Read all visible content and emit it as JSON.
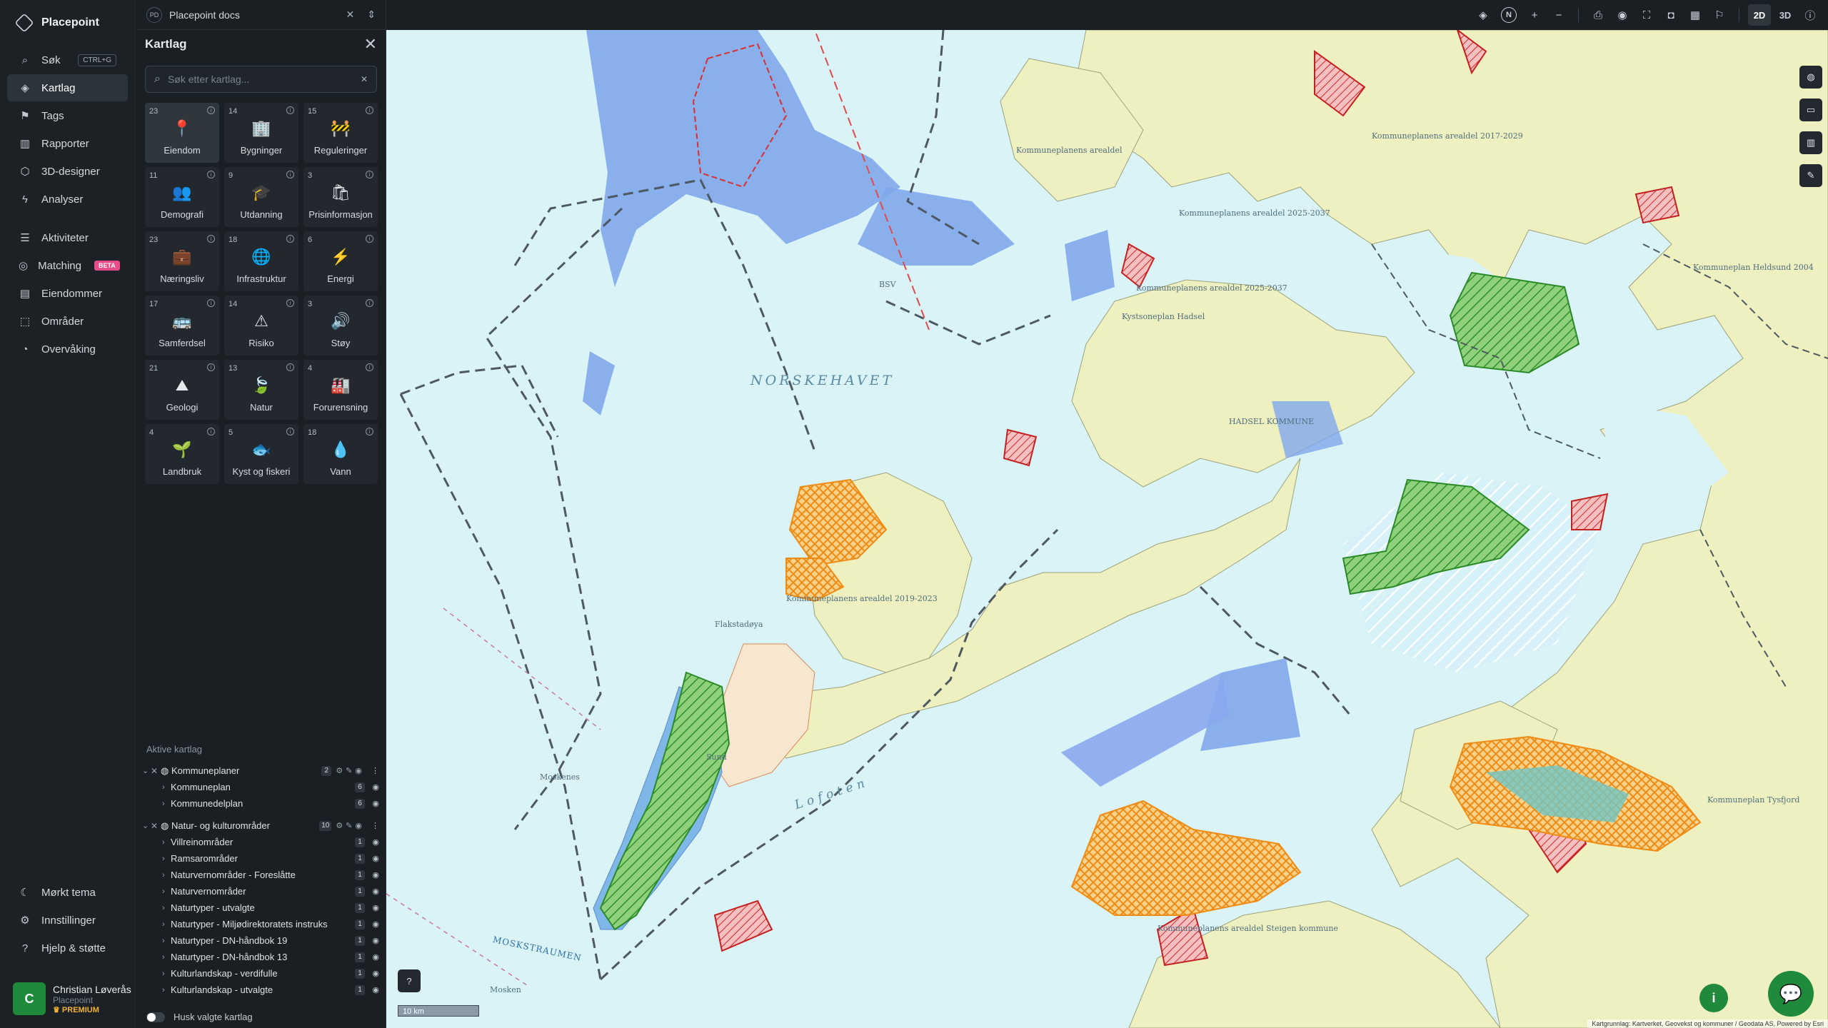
{
  "nav": {
    "brand": "Placepoint",
    "items": [
      {
        "label": "Søk",
        "shortcut": "CTRL+G"
      },
      {
        "label": "Kartlag"
      },
      {
        "label": "Tags"
      },
      {
        "label": "Rapporter"
      },
      {
        "label": "3D-designer"
      },
      {
        "label": "Analyser"
      },
      {
        "label": "Aktiviteter"
      },
      {
        "label": "Matching",
        "badge": "BETA"
      },
      {
        "label": "Eiendommer"
      },
      {
        "label": "Områder"
      },
      {
        "label": "Overvåking"
      }
    ],
    "bottom": [
      {
        "label": "Mørkt tema"
      },
      {
        "label": "Innstillinger"
      },
      {
        "label": "Hjelp & støtte"
      }
    ],
    "user": {
      "initial": "C",
      "name": "Christian Løverås",
      "org": "Placepoint",
      "plan": "PREMIUM"
    }
  },
  "doc": {
    "badge": "PD",
    "name": "Placepoint docs"
  },
  "panel": {
    "title": "Kartlag",
    "search_placeholder": "Søk etter kartlag...",
    "categories": [
      {
        "count": "23",
        "label": "Eiendom",
        "icon": "📍"
      },
      {
        "count": "14",
        "label": "Bygninger",
        "icon": "🏢"
      },
      {
        "count": "15",
        "label": "Reguleringer",
        "icon": "🚧"
      },
      {
        "count": "11",
        "label": "Demografi",
        "icon": "👥"
      },
      {
        "count": "9",
        "label": "Utdanning",
        "icon": "🎓"
      },
      {
        "count": "3",
        "label": "Prisinformasjon",
        "icon": "🛍"
      },
      {
        "count": "23",
        "label": "Næringsliv",
        "icon": "💼"
      },
      {
        "count": "18",
        "label": "Infrastruktur",
        "icon": "🌐"
      },
      {
        "count": "6",
        "label": "Energi",
        "icon": "⚡"
      },
      {
        "count": "17",
        "label": "Samferdsel",
        "icon": "🚌"
      },
      {
        "count": "14",
        "label": "Risiko",
        "icon": "⚠"
      },
      {
        "count": "3",
        "label": "Støy",
        "icon": "🔊"
      },
      {
        "count": "21",
        "label": "Geologi",
        "icon": "⛰"
      },
      {
        "count": "13",
        "label": "Natur",
        "icon": "🍃"
      },
      {
        "count": "4",
        "label": "Forurensning",
        "icon": "🏭"
      },
      {
        "count": "4",
        "label": "Landbruk",
        "icon": "🌱"
      },
      {
        "count": "5",
        "label": "Kyst og fiskeri",
        "icon": "🐟"
      },
      {
        "count": "18",
        "label": "Vann",
        "icon": "💧"
      }
    ],
    "active_title": "Aktive kartlag",
    "groups": [
      {
        "name": "Kommuneplaner",
        "count": "2",
        "children": [
          {
            "name": "Kommuneplan",
            "count": "6"
          },
          {
            "name": "Kommunedelplan",
            "count": "6"
          }
        ]
      },
      {
        "name": "Natur- og kulturområder",
        "count": "10",
        "children": [
          {
            "name": "Villreinområder",
            "count": "1"
          },
          {
            "name": "Ramsarområder",
            "count": "1"
          },
          {
            "name": "Naturvernområder - Foreslåtte",
            "count": "1"
          },
          {
            "name": "Naturvernområder",
            "count": "1"
          },
          {
            "name": "Naturtyper - utvalgte",
            "count": "1"
          },
          {
            "name": "Naturtyper - Miljødirektoratets instruks",
            "count": "1"
          },
          {
            "name": "Naturtyper - DN-håndbok 19",
            "count": "1"
          },
          {
            "name": "Naturtyper - DN-håndbok 13",
            "count": "1"
          },
          {
            "name": "Kulturlandskap - verdifulle",
            "count": "1"
          },
          {
            "name": "Kulturlandskap - utvalgte",
            "count": "1"
          }
        ]
      }
    ],
    "remember_label": "Husk valgte kartlag"
  },
  "toolbar": {
    "mode_2d": "2D",
    "mode_3d": "3D",
    "north": "N"
  },
  "map": {
    "labels": {
      "sea": "NORSKEHAVET",
      "lofoten": "Lofoten",
      "moskstraumen": "MOSKSTRAUMEN",
      "bsv": "BSV",
      "kp1": "Kommuneplanens arealdel",
      "kp2": "Kommuneplanens arealdel 2017-2029",
      "kp3": "Kommuneplanens arealdel 2025-2037",
      "kp4": "Kommuneplanens arealdel 2025-2037",
      "kp5": "Kommuneplanens arealdel 2019-2023",
      "kystsone": "Kystsoneplan Hadsel",
      "hadsel": "HADSEL KOMMUNE",
      "flakstad": "Flakstadøya",
      "moskenes": "Moskenes",
      "sund": "Sund",
      "mosken": "Mosken",
      "kp_sortland": "Kommuneplan Heldsund 2004",
      "kp_tysfjord": "Kommuneplan Tysfjord",
      "steigen": "Kommuneplanens arealdel Steigen kommune"
    },
    "scale_label": "10 km",
    "attribution": "Kartgrunnlag: Kartverket, Geovekst og kommuner / Geodata AS, Powered by Esri",
    "colors": {
      "land": "#eef0c0",
      "sea": "#d9f3f6",
      "water_plan": "#7fa8ec",
      "red_plan": "#d9302f",
      "green_zone": "#3fae3a",
      "orange_zone": "#f0931d"
    }
  }
}
